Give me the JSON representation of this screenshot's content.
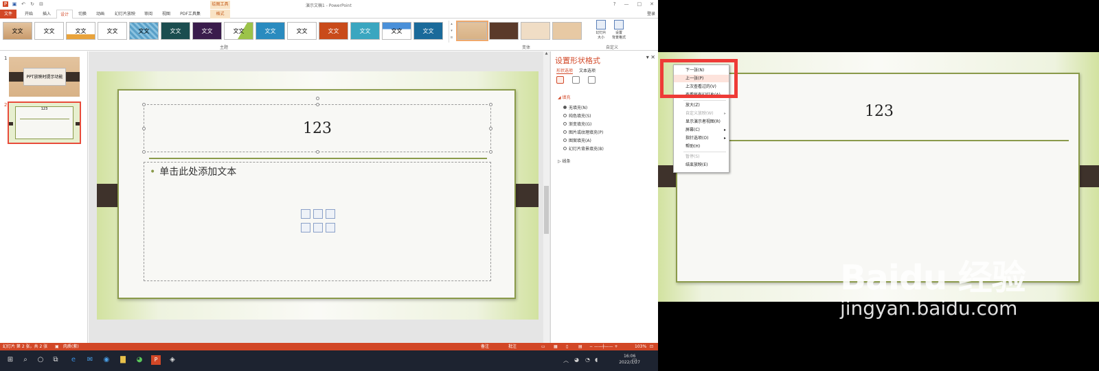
{
  "left": {
    "window_title": "演示文稿1 - PowerPoint",
    "contextual_tool": "绘图工具",
    "login": "登录",
    "window_buttons": [
      "?",
      "—",
      "□",
      "✕"
    ],
    "tabs": [
      "文件",
      "开始",
      "插入",
      "设计",
      "切换",
      "动画",
      "幻灯片放映",
      "审阅",
      "视图",
      "PDF工具集",
      "格式"
    ],
    "active_tab": "设计",
    "ribbon": {
      "themes_label": "主题",
      "variants_label": "变体",
      "custom_label": "自定义",
      "theme_thumbs": [
        "文文",
        "文文",
        "文文",
        "文文",
        "文文",
        "文文",
        "文文",
        "文文",
        "文文",
        "文文",
        "文文",
        "文文",
        "文文",
        "文文"
      ],
      "slide_size": "幻灯片\n大小",
      "format_bg": "设置\n背景格式"
    },
    "thumbnails": [
      {
        "num": "1",
        "text": "PPT放映时提示功能"
      },
      {
        "num": "2",
        "text": "123"
      }
    ],
    "slide": {
      "title": "123",
      "body_placeholder": "单击此处添加文本"
    },
    "format_pane": {
      "title": "设置形状格式",
      "tab_shape": "形状选项",
      "tab_text": "文本选项",
      "fill_section": "填充",
      "fill_options": [
        "无填充(N)",
        "纯色填充(S)",
        "渐变填充(G)",
        "图片或纹理填充(P)",
        "图案填充(A)",
        "幻灯片背景填充(B)"
      ],
      "selected_fill": 0,
      "line_section": "线条"
    },
    "status": {
      "slide_info": "幻灯片 第 2 张，共 2 张",
      "theme": "肉质(紫)",
      "notes": "备注",
      "comments": "批注",
      "zoom": "103%"
    },
    "taskbar": {
      "time": "16:06",
      "date": "2022/1/27"
    }
  },
  "right": {
    "slide_title": "123",
    "context_menu": [
      {
        "label": "下一张(N)",
        "disabled": false
      },
      {
        "label": "上一张(P)",
        "disabled": false,
        "highlight": true
      },
      {
        "label": "上次查看过的(V)",
        "disabled": false
      },
      {
        "label": "查看所有幻灯片(A)",
        "disabled": false
      },
      {
        "label": "放大(Z)",
        "disabled": false
      },
      {
        "label": "自定义放映(W)",
        "disabled": true,
        "submenu": true
      },
      {
        "label": "显示演示者视图(R)",
        "disabled": false
      },
      {
        "label": "屏幕(C)",
        "disabled": false,
        "submenu": true
      },
      {
        "label": "指针选项(O)",
        "disabled": false,
        "submenu": true
      },
      {
        "label": "帮助(H)",
        "disabled": false
      },
      {
        "label": "暂停(S)",
        "disabled": true
      },
      {
        "label": "结束放映(E)",
        "disabled": false
      }
    ],
    "watermark_logo": "Baidu 经验",
    "watermark_url": "jingyan.baidu.com"
  },
  "colors": {
    "accent": "#d24726",
    "highlight_box": "#ee3b37",
    "slide_rule": "#8a9a4a"
  }
}
